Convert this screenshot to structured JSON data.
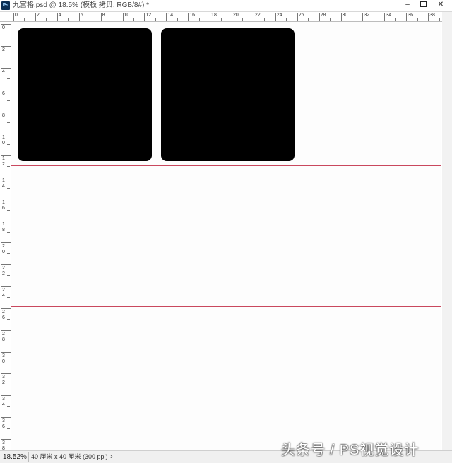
{
  "window": {
    "app_icon": "Ps",
    "title": "九宫格.psd @ 18.5% (模板 拷贝, RGB/8#) *",
    "minimize_icon": "minimize-icon",
    "maximize_icon": "maximize-icon",
    "close_icon": "close-icon",
    "minimize_label": "–",
    "close_label": "✕"
  },
  "ruler": {
    "top_labels": [
      "0",
      "2",
      "4",
      "6",
      "8",
      "10",
      "12",
      "14",
      "16",
      "18",
      "20",
      "22",
      "24",
      "26",
      "28",
      "30",
      "32",
      "34",
      "36",
      "38"
    ],
    "left_labels": [
      "0",
      "2",
      "4",
      "6",
      "8",
      "10",
      "12",
      "14",
      "16",
      "18",
      "20",
      "22",
      "24",
      "26",
      "28",
      "30",
      "32",
      "34",
      "36",
      "38"
    ]
  },
  "canvas": {
    "background": "#fdfdfd",
    "guide_color": "#c9485e",
    "shape_color": "#000000",
    "shapes": [
      "rounded-rect-1",
      "rounded-rect-2"
    ]
  },
  "status": {
    "zoom": "18.52%",
    "doc_size": "40 厘米 x 40 厘米 (300 ppi)",
    "arrow": "›"
  },
  "watermark": "头条号 / PS视觉设计"
}
